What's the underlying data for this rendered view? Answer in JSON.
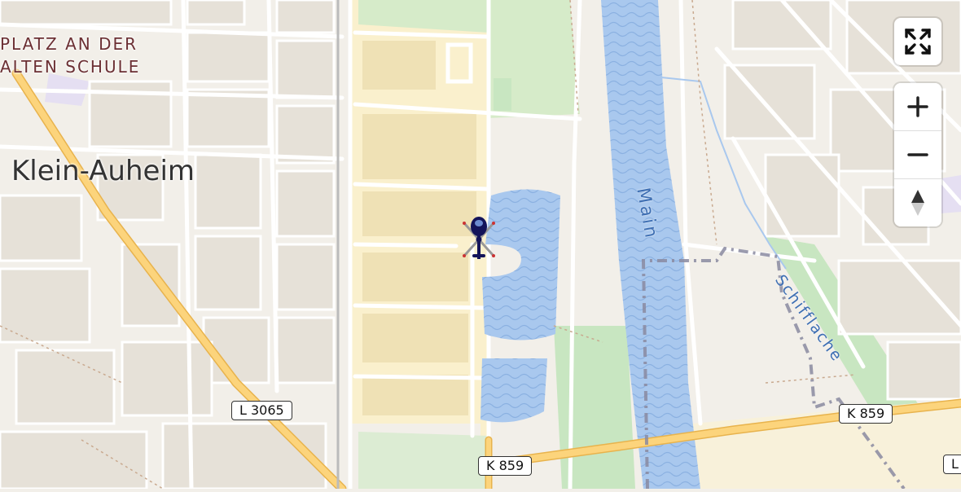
{
  "map": {
    "place_label_lines": [
      "PLATZ AN DER",
      "ALTEN SCHULE"
    ],
    "city_label": "Klein-Auheim",
    "river_label": "Main",
    "canal_label": "Schifflache",
    "road_shields": {
      "l3065": "L 3065",
      "k859_bottom": "K 859",
      "k859_right": "K 859",
      "edge_partial": "L"
    },
    "colors": {
      "background": "#f2efe9",
      "water": "#a9c8ee",
      "park": "#c8e6c1",
      "industrial": "#faf0cd",
      "road_major": "#fcd47c",
      "boundary": "#8a8aa0",
      "place_label": "#6b2f33"
    }
  },
  "controls": {
    "fullscreen": "fullscreen-toggle",
    "zoom_in": "+",
    "zoom_out": "−",
    "reset_north": "compass"
  },
  "aircraft": {
    "icon": "helicopter-icon",
    "color": "#14145a"
  }
}
